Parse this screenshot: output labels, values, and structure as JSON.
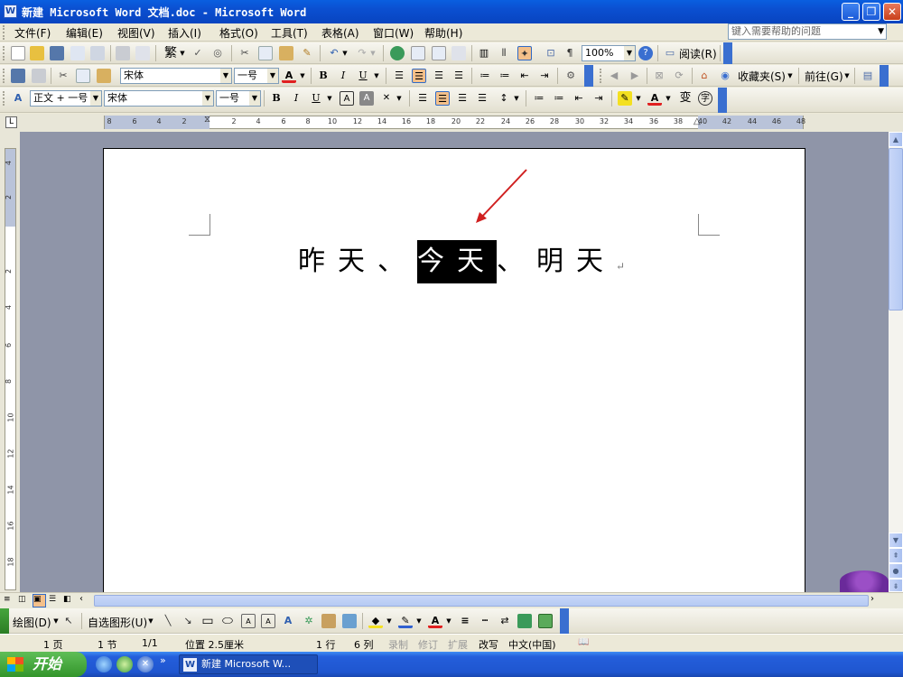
{
  "window": {
    "title": "新建 Microsoft Word 文档.doc - Microsoft Word"
  },
  "menu": {
    "items": [
      "文件(F)",
      "编辑(E)",
      "视图(V)",
      "插入(I)",
      "格式(O)",
      "工具(T)",
      "表格(A)",
      "窗口(W)",
      "帮助(H)"
    ],
    "help_placeholder": "键入需要帮助的问题"
  },
  "toolbar1": {
    "trad_simpl": "繁",
    "zoom": "100%",
    "read_label": "阅读(R)"
  },
  "toolbar2": {
    "font": "宋体",
    "size": "一号",
    "favorites_label": "收藏夹(S)",
    "go_label": "前往(G)"
  },
  "toolbar3": {
    "style": "正文 + 一号",
    "font": "宋体",
    "size": "一号"
  },
  "ruler": {
    "h_numbers": [
      "8",
      "6",
      "4",
      "2",
      "2",
      "4",
      "6",
      "8",
      "10",
      "12",
      "14",
      "16",
      "18",
      "20",
      "22",
      "24",
      "26",
      "28",
      "30",
      "32",
      "34",
      "36",
      "38",
      "40",
      "42",
      "44",
      "46",
      "48"
    ],
    "v_numbers": [
      "4",
      "2",
      "2",
      "4",
      "6",
      "8",
      "10",
      "12",
      "14",
      "16",
      "18"
    ]
  },
  "document": {
    "before": "昨天、",
    "selected": "今天",
    "after": "、明天",
    "annotation_color": "#d02020"
  },
  "drawbar": {
    "draw_label": "绘图(D)",
    "autoshapes_label": "自选图形(U)"
  },
  "status": {
    "page": "1 页",
    "section": "1 节",
    "page_of": "1/1",
    "position": "位置 2.5厘米",
    "line": "1 行",
    "column": "6 列",
    "rec": "录制",
    "trk": "修订",
    "ext": "扩展",
    "ovr": "改写",
    "language": "中文(中国)"
  },
  "taskbar": {
    "start_label": "开始",
    "task_label": "新建 Microsoft W..."
  }
}
